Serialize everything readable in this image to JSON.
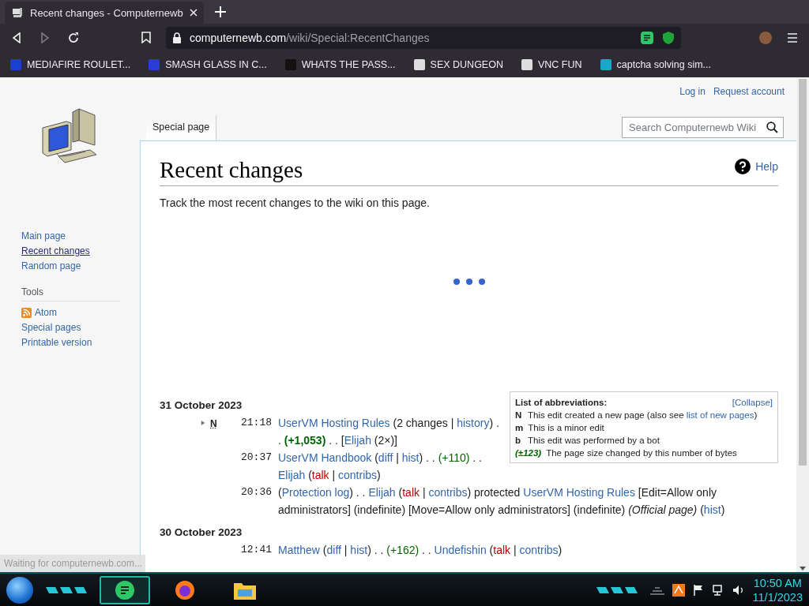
{
  "browser": {
    "tab": {
      "title": "Recent changes - Computernewb",
      "selected": true
    },
    "nav": {
      "back_disabled": false,
      "forward_disabled": true
    },
    "url": {
      "domain": "computernewb.com",
      "path": "/wiki/Special:RecentChanges"
    },
    "bookmarks": [
      {
        "label": "MEDIAFIRE ROULET..."
      },
      {
        "label": "SMASH GLASS IN C..."
      },
      {
        "label": "WHATS THE PASS..."
      },
      {
        "label": "SEX DUNGEON"
      },
      {
        "label": "VNC FUN"
      },
      {
        "label": "captcha solving sim..."
      }
    ],
    "status": "Waiting for computernewb.com..."
  },
  "wiki": {
    "personal": [
      "Log in",
      "Request account"
    ],
    "tab": {
      "label": "Special page",
      "selected": true
    },
    "search": {
      "placeholder": "Search Computernewb Wiki"
    },
    "nav": [
      {
        "label": "Main page",
        "hovered": false
      },
      {
        "label": "Recent changes",
        "hovered": true
      },
      {
        "label": "Random page",
        "hovered": false
      }
    ],
    "tools": {
      "heading": "Tools",
      "items": [
        {
          "label": "Atom",
          "kind": "feed"
        },
        {
          "label": "Special pages",
          "kind": "link"
        },
        {
          "label": "Printable version",
          "kind": "link"
        }
      ]
    },
    "title": "Recent changes",
    "help": "Help",
    "description": "Track the most recent changes to the wiki on this page.",
    "loading": true,
    "legend": {
      "title": "List of abbreviations:",
      "toggle": "[Collapse]",
      "rows": [
        {
          "key": "N",
          "kind": "flag",
          "segments": [
            {
              "kind": "text",
              "text": "This edit created a new page (also see "
            },
            {
              "kind": "link",
              "text": "list of new pages"
            },
            {
              "kind": "text",
              "text": ")"
            }
          ]
        },
        {
          "key": "m",
          "kind": "flag",
          "segments": [
            {
              "kind": "text",
              "text": "This is a minor edit"
            }
          ]
        },
        {
          "key": "b",
          "kind": "flag",
          "segments": [
            {
              "kind": "text",
              "text": "This edit was performed by a bot"
            }
          ]
        },
        {
          "key": "(±123)",
          "kind": "size",
          "segments": [
            {
              "kind": "text",
              "text": "The page size changed by this number of bytes"
            }
          ]
        }
      ]
    },
    "days": [
      {
        "date": "31 October 2023",
        "entries": [
          {
            "expanded": false,
            "flag": "N",
            "time": "21:18",
            "segments": [
              {
                "kind": "link",
                "text": "UserVM Hosting Rules"
              },
              {
                "kind": "text",
                "text": " (2 changes | "
              },
              {
                "kind": "link",
                "text": "history"
              },
              {
                "kind": "text",
                "text": ") . . "
              },
              {
                "kind": "added",
                "text": "(+1,053)"
              },
              {
                "kind": "text",
                "text": " . . ["
              },
              {
                "kind": "link",
                "text": "Elijah"
              },
              {
                "kind": "text",
                "text": " (2×)]"
              }
            ]
          },
          {
            "time": "20:37",
            "segments": [
              {
                "kind": "link",
                "text": "UserVM Handbook"
              },
              {
                "kind": "text",
                "text": " ("
              },
              {
                "kind": "link",
                "text": "diff"
              },
              {
                "kind": "text",
                "text": " | "
              },
              {
                "kind": "link",
                "text": "hist"
              },
              {
                "kind": "text",
                "text": ") . . "
              },
              {
                "kind": "delta",
                "text": "(+110)"
              },
              {
                "kind": "text",
                "text": " . . "
              },
              {
                "kind": "link",
                "text": "Elijah"
              },
              {
                "kind": "text",
                "text": " ("
              },
              {
                "kind": "redlink",
                "text": "talk"
              },
              {
                "kind": "text",
                "text": " | "
              },
              {
                "kind": "link",
                "text": "contribs"
              },
              {
                "kind": "text",
                "text": ")"
              }
            ]
          },
          {
            "time": "20:36",
            "segments": [
              {
                "kind": "text",
                "text": "("
              },
              {
                "kind": "link",
                "text": "Protection log"
              },
              {
                "kind": "text",
                "text": ") . . "
              },
              {
                "kind": "link",
                "text": "Elijah"
              },
              {
                "kind": "text",
                "text": " ("
              },
              {
                "kind": "redlink",
                "text": "talk"
              },
              {
                "kind": "text",
                "text": " | "
              },
              {
                "kind": "link",
                "text": "contribs"
              },
              {
                "kind": "text",
                "text": ") protected "
              },
              {
                "kind": "link",
                "text": "UserVM Hosting Rules"
              },
              {
                "kind": "text",
                "text": " [Edit=Allow only administrators] (indefinite) [Move=Allow only administrators] (indefinite) "
              },
              {
                "kind": "italic",
                "text": "(Official page)"
              },
              {
                "kind": "text",
                "text": " ("
              },
              {
                "kind": "link",
                "text": "hist"
              },
              {
                "kind": "text",
                "text": ")"
              }
            ]
          }
        ]
      },
      {
        "date": "30 October 2023",
        "entries": [
          {
            "time": "12:41",
            "segments": [
              {
                "kind": "link",
                "text": "Matthew"
              },
              {
                "kind": "text",
                "text": " ("
              },
              {
                "kind": "link",
                "text": "diff"
              },
              {
                "kind": "text",
                "text": " | "
              },
              {
                "kind": "link",
                "text": "hist"
              },
              {
                "kind": "text",
                "text": ") . . "
              },
              {
                "kind": "delta",
                "text": "(+162)"
              },
              {
                "kind": "text",
                "text": " . . "
              },
              {
                "kind": "link",
                "text": "Undefishin"
              },
              {
                "kind": "text",
                "text": " ("
              },
              {
                "kind": "redlink",
                "text": "talk"
              },
              {
                "kind": "text",
                "text": " | "
              },
              {
                "kind": "link",
                "text": "contribs"
              },
              {
                "kind": "text",
                "text": ")"
              }
            ]
          }
        ]
      }
    ]
  },
  "taskbar": {
    "apps": [
      {
        "selected": true
      },
      {
        "selected": false
      },
      {
        "selected": false
      }
    ],
    "clock": {
      "time": "10:50 AM",
      "date": "11/1/2023"
    }
  }
}
